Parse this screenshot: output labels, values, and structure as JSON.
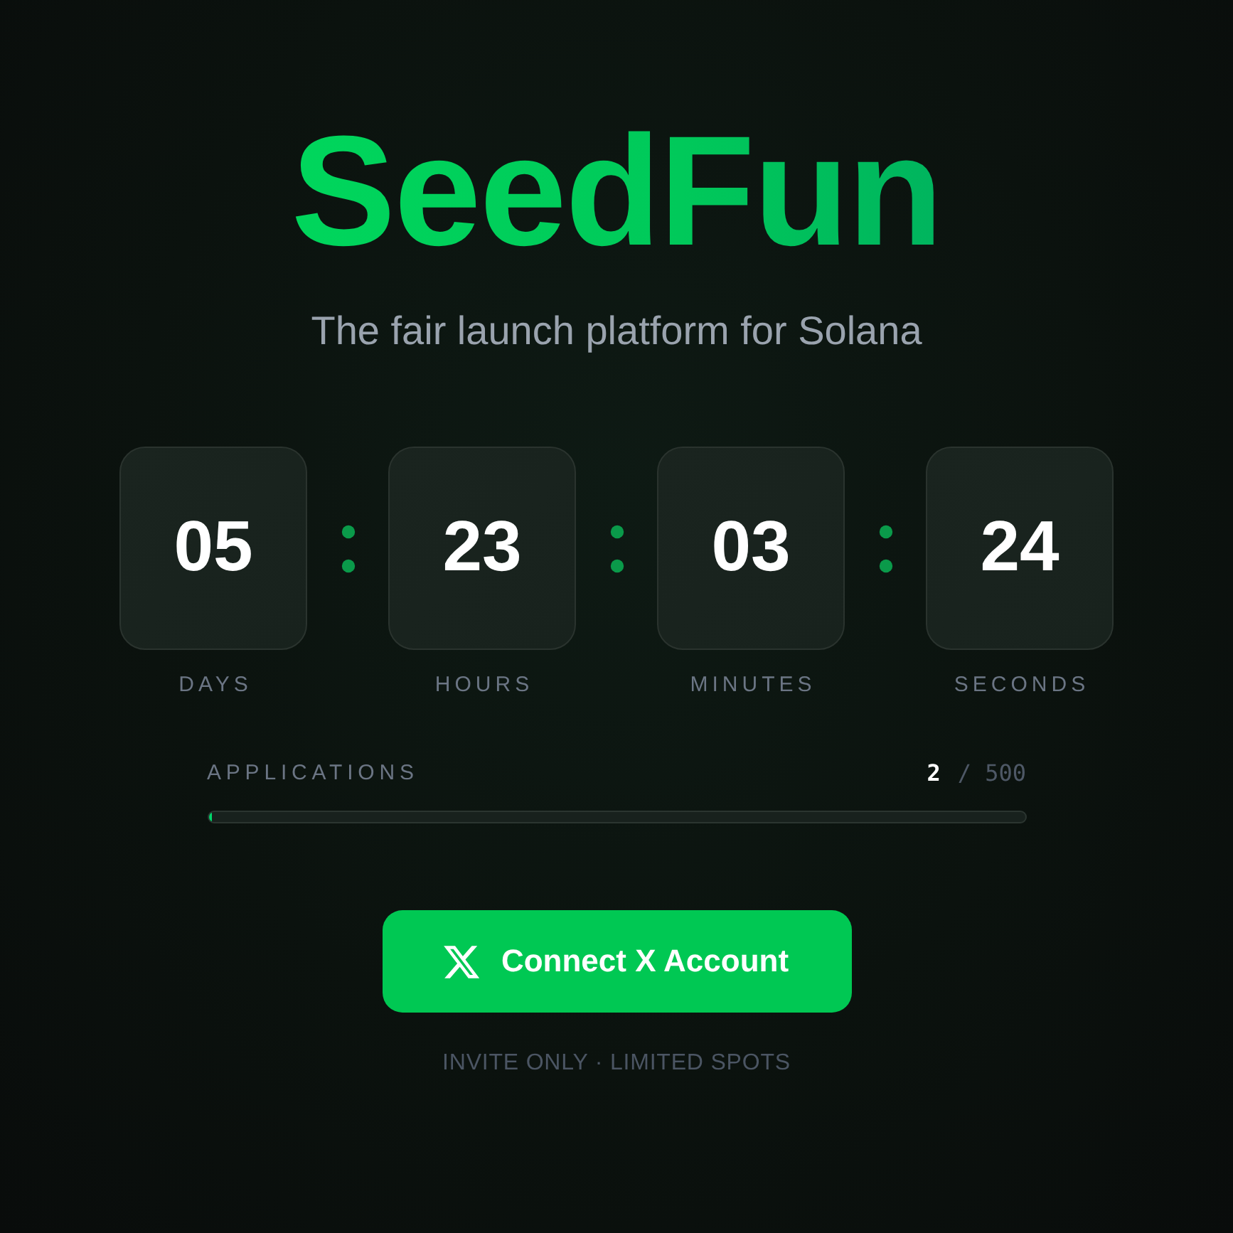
{
  "brand": {
    "title": "SeedFun",
    "tagline": "The fair launch platform for Solana"
  },
  "countdown": [
    {
      "value": "05",
      "unit": "DAYS"
    },
    {
      "value": "23",
      "unit": "HOURS"
    },
    {
      "value": "03",
      "unit": "MINUTES"
    },
    {
      "value": "24",
      "unit": "SECONDS"
    }
  ],
  "applications": {
    "label": "APPLICATIONS",
    "count": "2",
    "limit": "/ 500",
    "level": 0.004
  },
  "connect_button": {
    "label": "Connect X Account"
  },
  "footnote": "INVITE ONLY · LIMITED SPOTS"
}
